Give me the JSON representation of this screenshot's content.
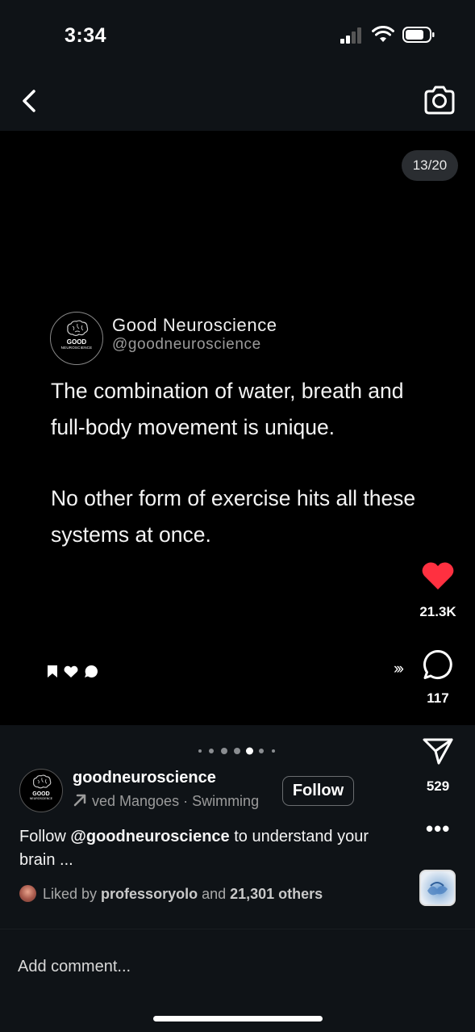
{
  "status_bar": {
    "time": "3:34"
  },
  "post": {
    "counter": "13/20",
    "tweet": {
      "name": "Good Neuroscience",
      "handle": "@goodneuroscience",
      "avatar_brand": "GOOD",
      "avatar_sub": "NEUROSCIENCE",
      "paragraphs": [
        "The combination of water, breath and full-body movement is unique.",
        "No other form of exercise hits all these systems at once."
      ]
    }
  },
  "actions": {
    "likes": "21.3K",
    "comments": "117",
    "shares": "529",
    "chevrons": "›››",
    "more": "•••",
    "like_color": "#ff3040"
  },
  "carousel": {
    "dot_count": 7,
    "active_index": 4
  },
  "author": {
    "username": "goodneuroscience",
    "avatar_brand": "GOOD",
    "avatar_sub": "NEUROSCIENCE",
    "audio": "ved Mangoes · Swimming",
    "follow_label": "Follow"
  },
  "caption": {
    "prefix": "Follow ",
    "mention": "@goodneuroscience",
    "suffix": " to understand your brain ..."
  },
  "liked_by": {
    "prefix": "Liked by ",
    "user": "professoryolo",
    "middle": " and ",
    "others": "21,301 others"
  },
  "comment": {
    "placeholder": "Add comment..."
  }
}
